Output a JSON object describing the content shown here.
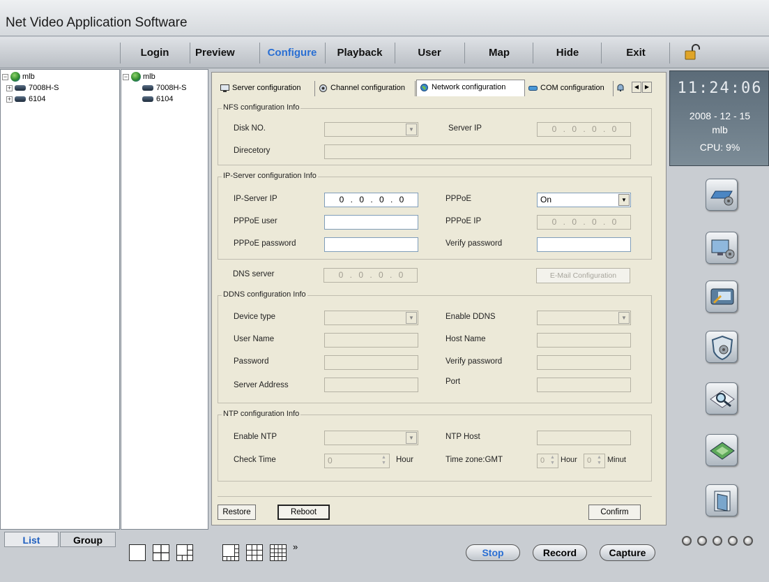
{
  "app": {
    "title": "Net Video Application Software"
  },
  "menu": {
    "items": [
      "Login",
      "Preview",
      "Configure",
      "Playback",
      "User",
      "Map",
      "Hide",
      "Exit"
    ],
    "active": "Configure",
    "accent_color": "#2a6fd3"
  },
  "tree_left": {
    "root": "mlb",
    "children": [
      "7008H-S",
      "6104"
    ]
  },
  "tree_right": {
    "root": "mlb",
    "children": [
      "7008H-S",
      "6104"
    ]
  },
  "tabs": [
    "Server configuration",
    "Channel configuration",
    "Network configuration",
    "COM configuration"
  ],
  "selected_tab": "Network configuration",
  "nfs": {
    "title": "NFS configuration Info",
    "disk_label": "Disk NO.",
    "disk_value": "",
    "server_ip_label": "Server IP",
    "server_ip_value": "0 . 0 . 0 . 0",
    "directory_label": "Direcetory",
    "directory_value": ""
  },
  "ipserver": {
    "title": "IP-Server configuration Info",
    "ip_label": "IP-Server  IP",
    "ip_value": "0 . 0 . 0 . 0",
    "pppoe_label": "PPPoE",
    "pppoe_value": "On",
    "user_label": "PPPoE user",
    "user_value": "",
    "pppoe_ip_label": "PPPoE IP",
    "pppoe_ip_value": "0 . 0 . 0 . 0",
    "password_label": "PPPoE password",
    "password_value": "",
    "verify_label": "Verify password",
    "verify_value": ""
  },
  "dns": {
    "label": "DNS server",
    "value": "0 . 0 . 0 . 0",
    "email_button": "E-Mail Configuration"
  },
  "ddns": {
    "title": "DDNS configuration Info",
    "device_type_label": "Device type",
    "device_type_value": "",
    "enable_label": "Enable DDNS",
    "enable_value": "",
    "user_label": "User Name",
    "user_value": "",
    "host_label": "Host Name",
    "host_value": "",
    "password_label": "Password",
    "password_value": "",
    "verify_label": "Verify password",
    "verify_value": "",
    "server_label": "Server Address",
    "server_value": "",
    "port_label": "Port",
    "port_value": ""
  },
  "ntp": {
    "title": "NTP configuration Info",
    "enable_label": "Enable NTP",
    "enable_value": "",
    "host_label": "NTP Host",
    "host_value": "",
    "check_label": "Check Time",
    "check_value": "0",
    "hour_unit": "Hour",
    "tz_label": "Time zone:GMT",
    "tz_hour_value": "0",
    "tz_hour_unit": "Hour",
    "tz_min_value": "0",
    "tz_min_unit": "Minut"
  },
  "buttons": {
    "restore": "Restore",
    "reboot": "Reboot",
    "confirm": "Confirm"
  },
  "status": {
    "time": "11:24:06",
    "date": "2008 - 12 - 15",
    "user": "mlb",
    "cpu": "CPU: 9%"
  },
  "bottom": {
    "tabs": [
      "List",
      "Group"
    ],
    "more": "»",
    "stop": "Stop",
    "record": "Record",
    "capture": "Capture"
  }
}
